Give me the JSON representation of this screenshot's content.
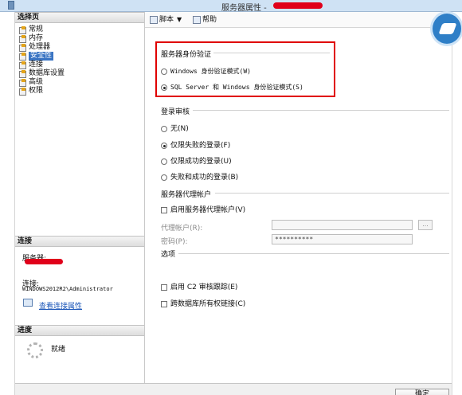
{
  "window": {
    "title": "服务器属性 -"
  },
  "left_panel": {
    "select_page_header": "选择页",
    "pages": [
      {
        "label": "常规"
      },
      {
        "label": "内存"
      },
      {
        "label": "处理器"
      },
      {
        "label": "安全性"
      },
      {
        "label": "连接"
      },
      {
        "label": "数据库设置"
      },
      {
        "label": "高级"
      },
      {
        "label": "权限"
      }
    ],
    "active_page": "安全性",
    "connection_header": "连接",
    "server_label": "服务器:",
    "connection_label": "连接:",
    "connection_value": "WINDOWS2012R2\\Administrator",
    "view_connection_link": "查看连接属性",
    "progress_header": "进度",
    "progress_status": "就绪"
  },
  "toolbar": {
    "script_label": "脚本",
    "help_label": "帮助"
  },
  "auth": {
    "group_title": "服务器身份验证",
    "options": [
      {
        "label": "Windows 身份验证模式(W)",
        "selected": false
      },
      {
        "label": "SQL Server 和 Windows 身份验证模式(S)",
        "selected": true
      }
    ]
  },
  "audit": {
    "group_title": "登录审核",
    "options": [
      {
        "label": "无(N)",
        "selected": false
      },
      {
        "label": "仅限失败的登录(F)",
        "selected": true
      },
      {
        "label": "仅限成功的登录(U)",
        "selected": false
      },
      {
        "label": "失败和成功的登录(B)",
        "selected": false
      }
    ]
  },
  "proxy": {
    "group_title": "服务器代理帐户",
    "enable_label": "启用服务器代理帐户(V)",
    "enabled": false,
    "account_label": "代理帐户(R):",
    "account_value": "",
    "password_label": "密码(P):",
    "password_value": "**********",
    "browse_label": "..."
  },
  "options": {
    "group_title": "选项",
    "c2_label": "启用 C2 审核跟踪(E)",
    "c2_enabled": false,
    "cross_db_label": "跨数据库所有权链接(C)",
    "cross_db_enabled": false
  },
  "footer": {
    "ok_label": "确定"
  },
  "colors": {
    "highlight": "#e00000",
    "selection": "#3a74c3",
    "link": "#1a55b8",
    "redaction": "#e0001a"
  }
}
